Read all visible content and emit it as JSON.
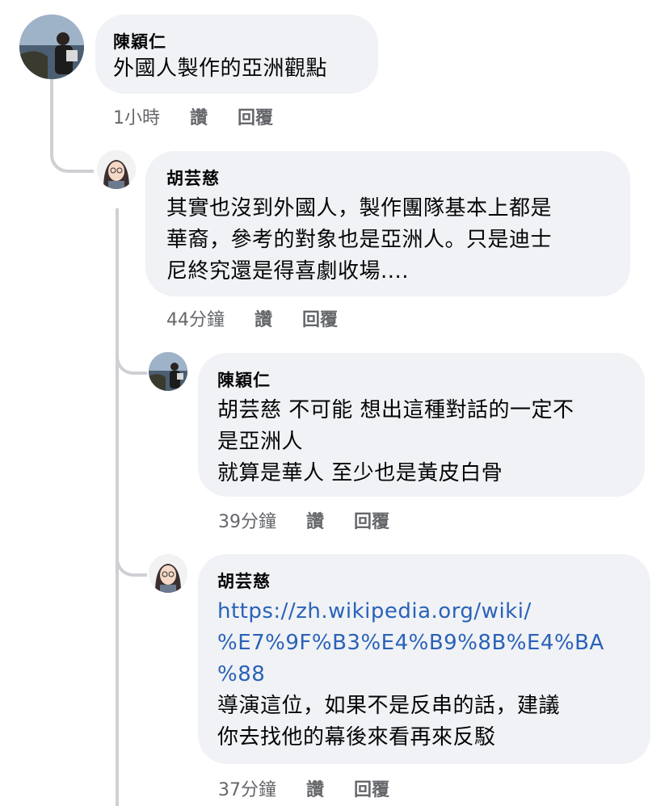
{
  "comments": [
    {
      "author": "陳穎仁",
      "lines": [
        "外國人製作的亞洲觀點"
      ],
      "time": "1小時",
      "like": "讚",
      "reply": "回覆"
    },
    {
      "author": "胡芸慈",
      "lines": [
        "其實也沒到外國人，製作團隊基本上都是",
        "華裔，參考的對象也是亞洲人。只是迪士",
        "尼終究還是得喜劇收場...."
      ],
      "time": "44分鐘",
      "like": "讚",
      "reply": "回覆"
    },
    {
      "author": "陳穎仁",
      "lines": [
        "胡芸慈 不可能 想出這種對話的一定不",
        "是亞洲人",
        "就算是華人 至少也是黃皮白骨"
      ],
      "time": "39分鐘",
      "like": "讚",
      "reply": "回覆"
    },
    {
      "author": "胡芸慈",
      "link_lines": [
        "https://zh.wikipedia.org/wiki/",
        "%E7%9F%B3%E4%B9%8B%E4%BA",
        "%88"
      ],
      "lines": [
        "導演這位，如果不是反串的話，建議",
        "你去找他的幕後來看再來反駁"
      ],
      "time": "37分鐘",
      "like": "讚",
      "reply": "回覆"
    }
  ]
}
